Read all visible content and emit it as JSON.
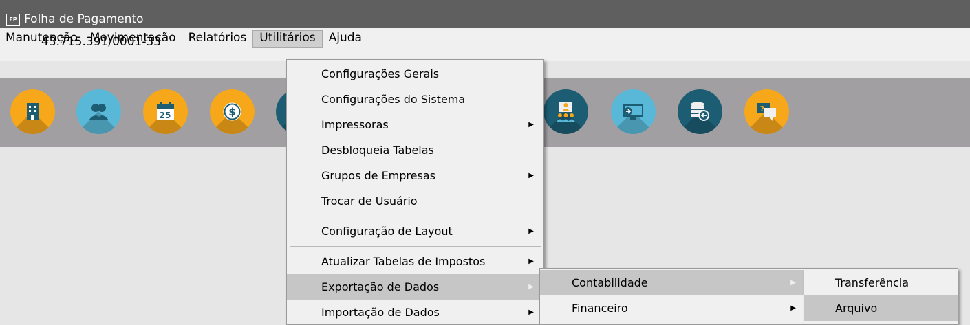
{
  "window": {
    "title": "Folha de Pagamento",
    "icon_label": "FP"
  },
  "menubar": {
    "items": [
      "Manutenção",
      "Movimentação",
      "Relatórios",
      "Utilitários",
      "Ajuda"
    ],
    "active": "Utilitários"
  },
  "company": {
    "cnpj": "43.715.391/0001-33"
  },
  "toolbar": {
    "buttons": [
      {
        "icon": "building-icon",
        "color": "#f6a71a"
      },
      {
        "icon": "users-icon",
        "color": "#59b8d8"
      },
      {
        "icon": "calendar-icon",
        "color": "#f6a71a",
        "text": "25"
      },
      {
        "icon": "dollar-coin-icon",
        "color": "#f6a71a",
        "text": "$"
      },
      {
        "icon": "partial-icon",
        "color": "#1d5d73"
      },
      {
        "icon": "presentation-icon",
        "color": "#1d5d73"
      },
      {
        "icon": "monitor-export-icon",
        "color": "#59b8d8"
      },
      {
        "icon": "database-import-icon",
        "color": "#1d5d73"
      },
      {
        "icon": "help-chat-icon",
        "color": "#f6a71a",
        "text": "?"
      }
    ]
  },
  "utilitarios_menu": {
    "items": [
      {
        "label": "Configurações Gerais"
      },
      {
        "label": "Configurações do Sistema"
      },
      {
        "label": "Impressoras",
        "submenu": true
      },
      {
        "label": "Desbloqueia Tabelas"
      },
      {
        "label": "Grupos de Empresas",
        "submenu": true
      },
      {
        "label": "Trocar de Usuário"
      },
      {
        "label": "Configuração de Layout",
        "submenu": true
      },
      {
        "label": "Atualizar Tabelas de Impostos",
        "submenu": true
      },
      {
        "label": "Exportação de Dados",
        "submenu": true,
        "highlighted": true
      },
      {
        "label": "Importação de Dados",
        "submenu": true
      }
    ]
  },
  "exportacao_menu": {
    "items": [
      {
        "label": "Contabilidade",
        "submenu": true,
        "highlighted": true
      },
      {
        "label": "Financeiro",
        "submenu": true
      }
    ]
  },
  "contabilidade_menu": {
    "items": [
      {
        "label": "Transferência"
      },
      {
        "label": "Arquivo",
        "highlighted": true
      }
    ]
  },
  "colors": {
    "titlebar": "#5f5f5f",
    "toolbar": "#a19fa1",
    "highlight": "#c6c6c6"
  }
}
